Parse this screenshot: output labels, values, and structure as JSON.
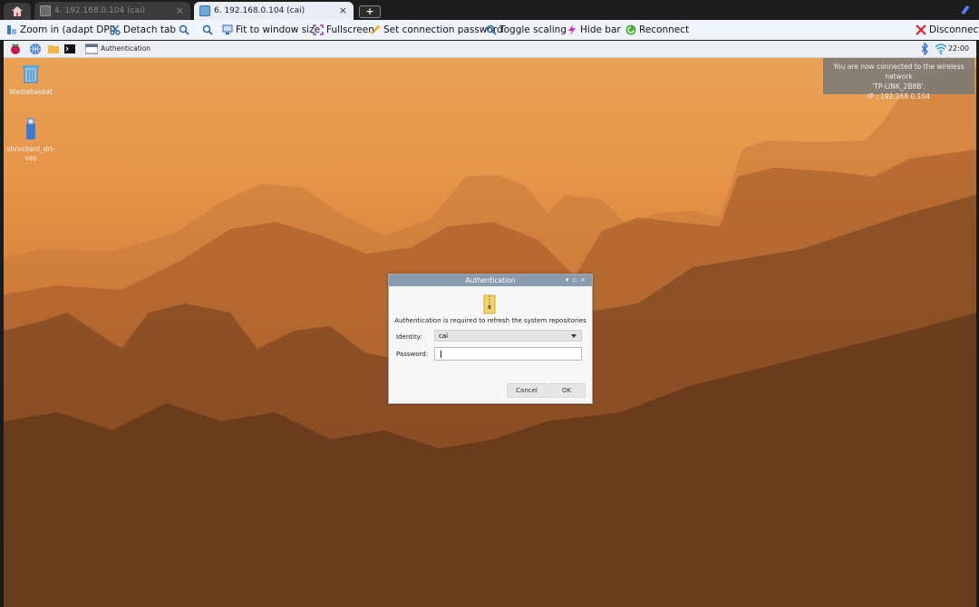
{
  "tabs": [
    {
      "label": "4. 192.168.0.104 (cai)",
      "close": "×"
    },
    {
      "label": "6. 192.168.0.104 (cai)",
      "close": "×"
    }
  ],
  "new_tab": "+",
  "toolbar": {
    "zoom_in": "Zoom in (adapt DPI)",
    "detach_tab": "Detach tab",
    "fit_window": "Fit to window size",
    "fullscreen": "Fullscreen",
    "set_password": "Set connection password",
    "toggle_scaling": "Toggle scaling",
    "hide_bar": "Hide bar",
    "reconnect": "Reconnect",
    "disconnect": "Disconnect"
  },
  "panel": {
    "window_label": "Authentication",
    "clock": "22:00"
  },
  "desktop": {
    "wastebasket": "Wastebasket",
    "drive": "shrvclient_dri-\nves"
  },
  "notification": {
    "line1": "You are now connected to the wireless network",
    "line2": "'TP-LINK_2B8B'.",
    "line3": "IP : 192.168.0.104"
  },
  "dialog": {
    "title": "Authentication",
    "message": "Authentication is required to refresh the system repositories",
    "identity_label": "Identity:",
    "identity_value": "cai",
    "password_label": "Password:",
    "cancel": "Cancel",
    "ok": "OK"
  }
}
